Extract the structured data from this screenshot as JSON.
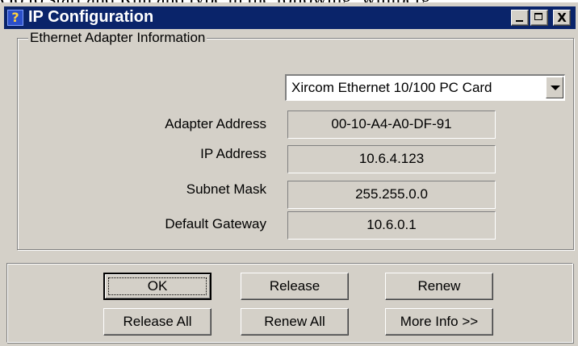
{
  "window": {
    "title": "IP Configuration",
    "title_icon": "help-question-icon",
    "controls": {
      "minimize_icon": "minimize-icon",
      "maximize_icon": "maximize-icon",
      "close_glyph": "X"
    }
  },
  "background_text": "Go to start and Run and type in the following: winipcfg",
  "group": {
    "label": "Ethernet  Adapter Information"
  },
  "adapter_select": {
    "value": "Xircom Ethernet 10/100 PC Card"
  },
  "fields": [
    {
      "label": "Adapter Address",
      "value": "00-10-A4-A0-DF-91"
    },
    {
      "label": "IP Address",
      "value": "10.6.4.123"
    },
    {
      "label": "Subnet Mask",
      "value": "255.255.0.0"
    },
    {
      "label": "Default Gateway",
      "value": "10.6.0.1"
    }
  ],
  "buttons": {
    "ok": "OK",
    "release": "Release",
    "renew": "Renew",
    "release_all": "Release All",
    "renew_all": "Renew All",
    "more_info": "More Info >>"
  },
  "colors": {
    "titlebar": "#0a246a",
    "face": "#d4d0c8"
  }
}
